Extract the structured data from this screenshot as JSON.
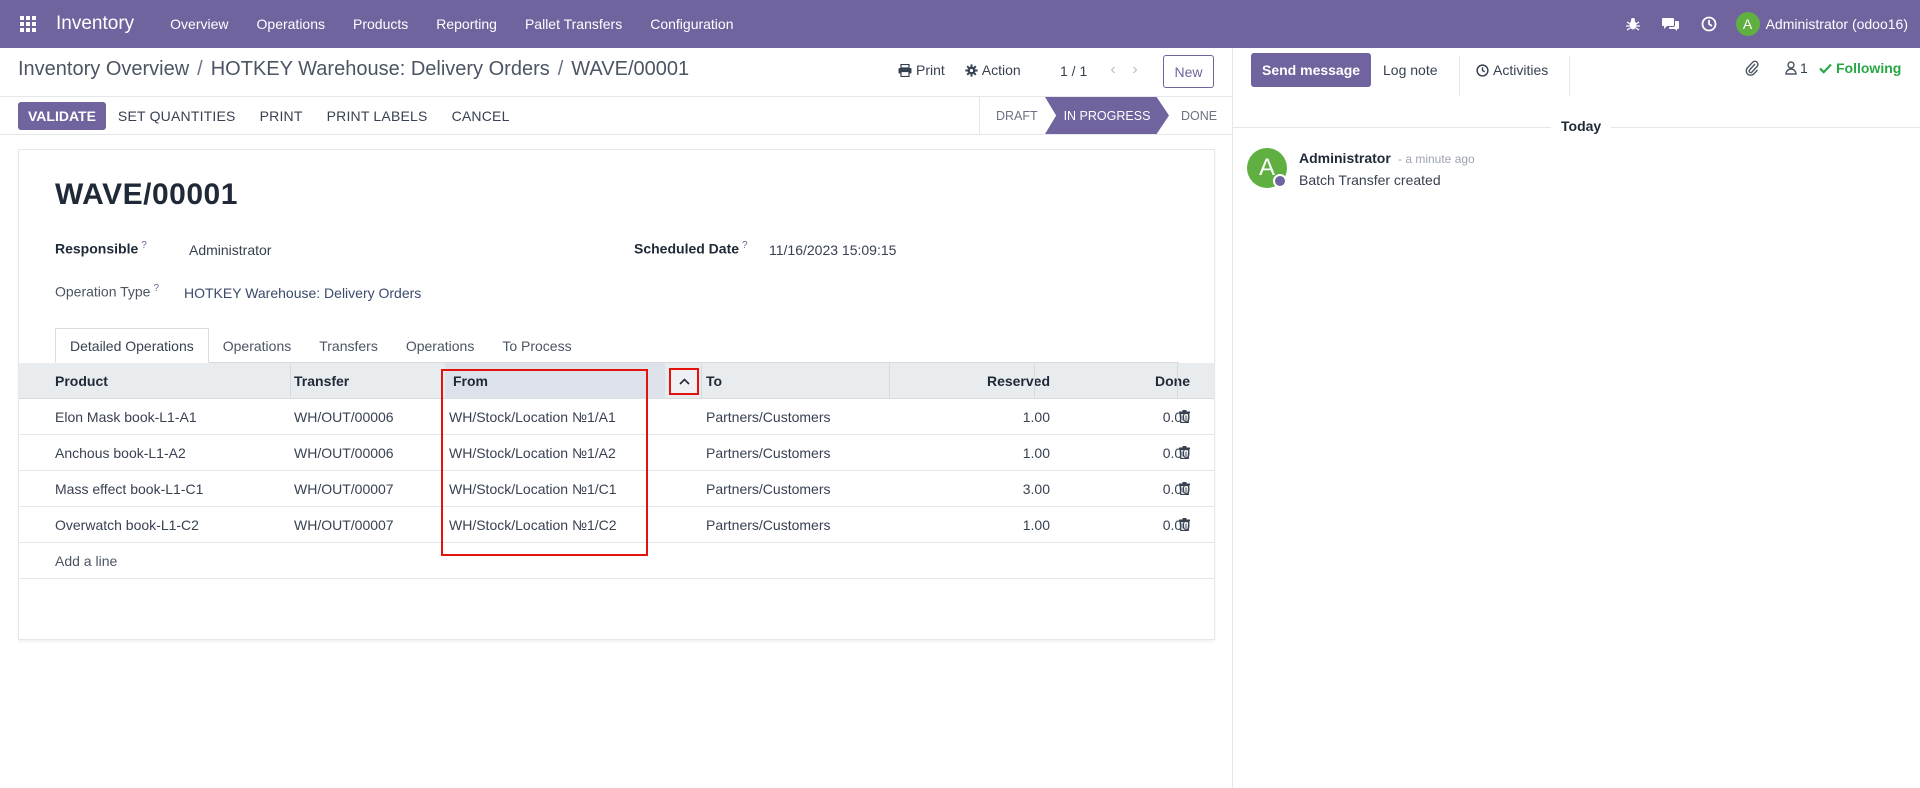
{
  "navbar": {
    "app_name": "Inventory",
    "menu": [
      "Overview",
      "Operations",
      "Products",
      "Reporting",
      "Pallet Transfers",
      "Configuration"
    ],
    "user_initial": "A",
    "user_name": "Administrator (odoo16)",
    "icons": [
      "bug-icon",
      "chat-icon",
      "clock-icon"
    ]
  },
  "breadcrumb": {
    "items": [
      "Inventory Overview",
      "HOTKEY Warehouse: Delivery Orders",
      "WAVE/00001"
    ],
    "separator": "/"
  },
  "control": {
    "print_label": "Print",
    "action_label": "Action",
    "pager": "1 / 1",
    "new_label": "New"
  },
  "statusbar": {
    "buttons": [
      "VALIDATE",
      "SET QUANTITIES",
      "PRINT",
      "PRINT LABELS",
      "CANCEL"
    ],
    "stages": [
      "DRAFT",
      "IN PROGRESS",
      "DONE"
    ],
    "active_stage": "IN PROGRESS"
  },
  "form": {
    "title": "WAVE/00001",
    "responsible_label": "Responsible",
    "responsible_value": "Administrator",
    "scheduled_label": "Scheduled Date",
    "scheduled_value": "11/16/2023 15:09:15",
    "optype_label": "Operation Type",
    "optype_value": "HOTKEY Warehouse: Delivery Orders",
    "help_mark": "?"
  },
  "tabs": [
    "Detailed Operations",
    "Operations",
    "Transfers",
    "Operations",
    "To Process"
  ],
  "table": {
    "headers": {
      "product": "Product",
      "transfer": "Transfer",
      "from": "From",
      "to": "To",
      "reserved": "Reserved",
      "done": "Done"
    },
    "rows": [
      {
        "product": "Elon Mask book-L1-A1",
        "transfer": "WH/OUT/00006",
        "from": "WH/Stock/Location №1/A1",
        "to": "Partners/Customers",
        "reserved": "1.00",
        "done": "0.00"
      },
      {
        "product": "Anchous book-L1-A2",
        "transfer": "WH/OUT/00006",
        "from": "WH/Stock/Location №1/A2",
        "to": "Partners/Customers",
        "reserved": "1.00",
        "done": "0.00"
      },
      {
        "product": "Mass effect book-L1-C1",
        "transfer": "WH/OUT/00007",
        "from": "WH/Stock/Location №1/C1",
        "to": "Partners/Customers",
        "reserved": "3.00",
        "done": "0.00"
      },
      {
        "product": "Overwatch book-L1-C2",
        "transfer": "WH/OUT/00007",
        "from": "WH/Stock/Location №1/C2",
        "to": "Partners/Customers",
        "reserved": "1.00",
        "done": "0.00"
      }
    ],
    "add_line": "Add a line"
  },
  "chatter": {
    "send_message": "Send message",
    "log_note": "Log note",
    "activities": "Activities",
    "followers_count": "1",
    "following": "Following",
    "date_separator": "Today",
    "message": {
      "author": "Administrator",
      "time": "- a minute ago",
      "body": "Batch Transfer created",
      "avatar_initial": "A"
    }
  },
  "colors": {
    "brand": "#71639e",
    "following": "#28a745",
    "highlight": "#e3120b",
    "avatar": "#5fb041"
  }
}
